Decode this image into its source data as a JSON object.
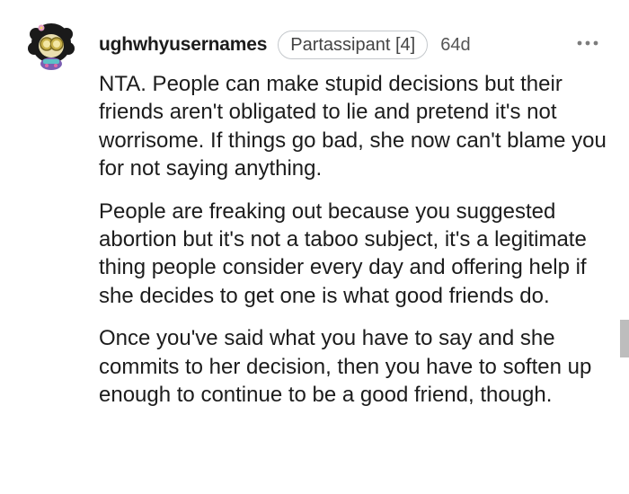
{
  "comment": {
    "author": {
      "username": "ughwhyusernames",
      "avatar_icon": "snoo-avatar-icon"
    },
    "flair": "Partassipant [4]",
    "age": "64d",
    "more_icon": "more-options-icon",
    "paragraphs": [
      "NTA. People can make stupid decisions but their friends aren't obligated to lie and pretend it's not worrisome. If things go bad, she now can't blame you for not saying anything.",
      "People are freaking out because you suggested abortion but it's not a taboo subject, it's a legitimate thing people consider every day and offering help if she decides to get one is what good friends do.",
      "Once you've said what you have to say and she commits to her decision, then you have to soften up enough to continue to be a good friend, though."
    ]
  },
  "colors": {
    "text": "#1c1c1c",
    "flair_border": "#c4c8cc",
    "muted": "#555555",
    "scrollbar": "#bdbdbd"
  }
}
